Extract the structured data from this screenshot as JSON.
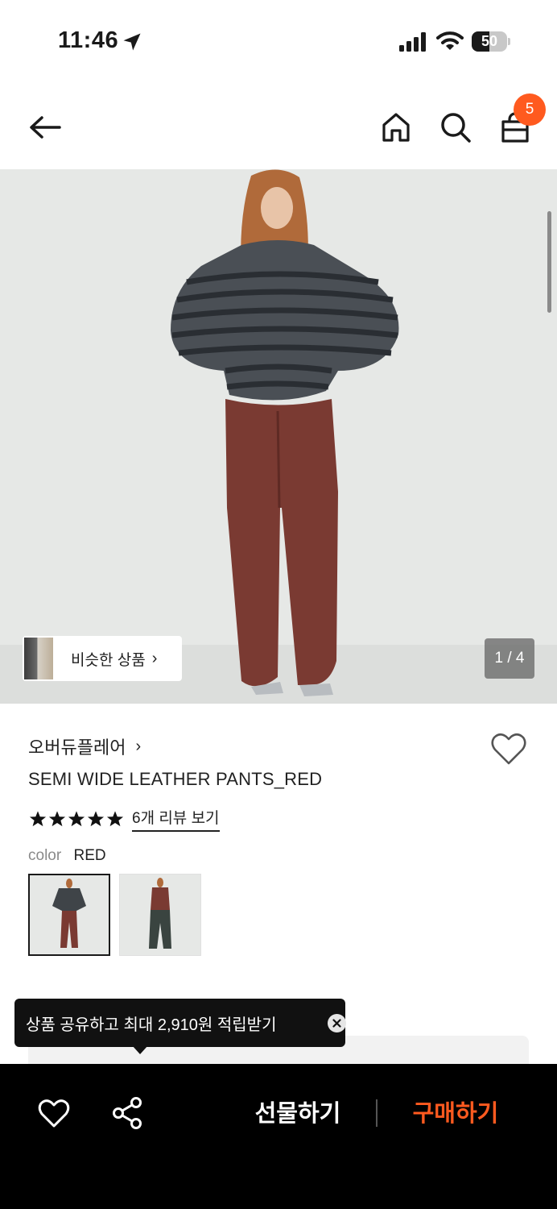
{
  "status_bar": {
    "time": "11:46",
    "battery": "50",
    "battery_level": 0.5
  },
  "nav": {
    "cart_count": "5"
  },
  "hero": {
    "similar_label": "비슷한 상품",
    "similar_chevron": "›",
    "page_counter": "1 / 4"
  },
  "product": {
    "brand": "오버듀플레어",
    "brand_chevron": "›",
    "title": "SEMI WIDE LEATHER PANTS_RED",
    "rating_stars": 5,
    "review_link": "6개 리뷰 보기",
    "color_label": "color",
    "color_value": "RED"
  },
  "tooltip": {
    "text": "상품 공유하고 최대 2,910원 적립받기"
  },
  "bottom_bar": {
    "gift_label": "선물하기",
    "buy_label": "구매하기"
  },
  "colors": {
    "accent": "#ff5a1f",
    "bottom_bar_bg": "#000000",
    "tooltip_bg": "#111111"
  },
  "icons": [
    "location-arrow-icon",
    "signal-icon",
    "wifi-icon",
    "back-arrow-icon",
    "home-icon",
    "search-icon",
    "cart-icon",
    "heart-icon",
    "star-icon",
    "share-icon",
    "close-icon"
  ]
}
